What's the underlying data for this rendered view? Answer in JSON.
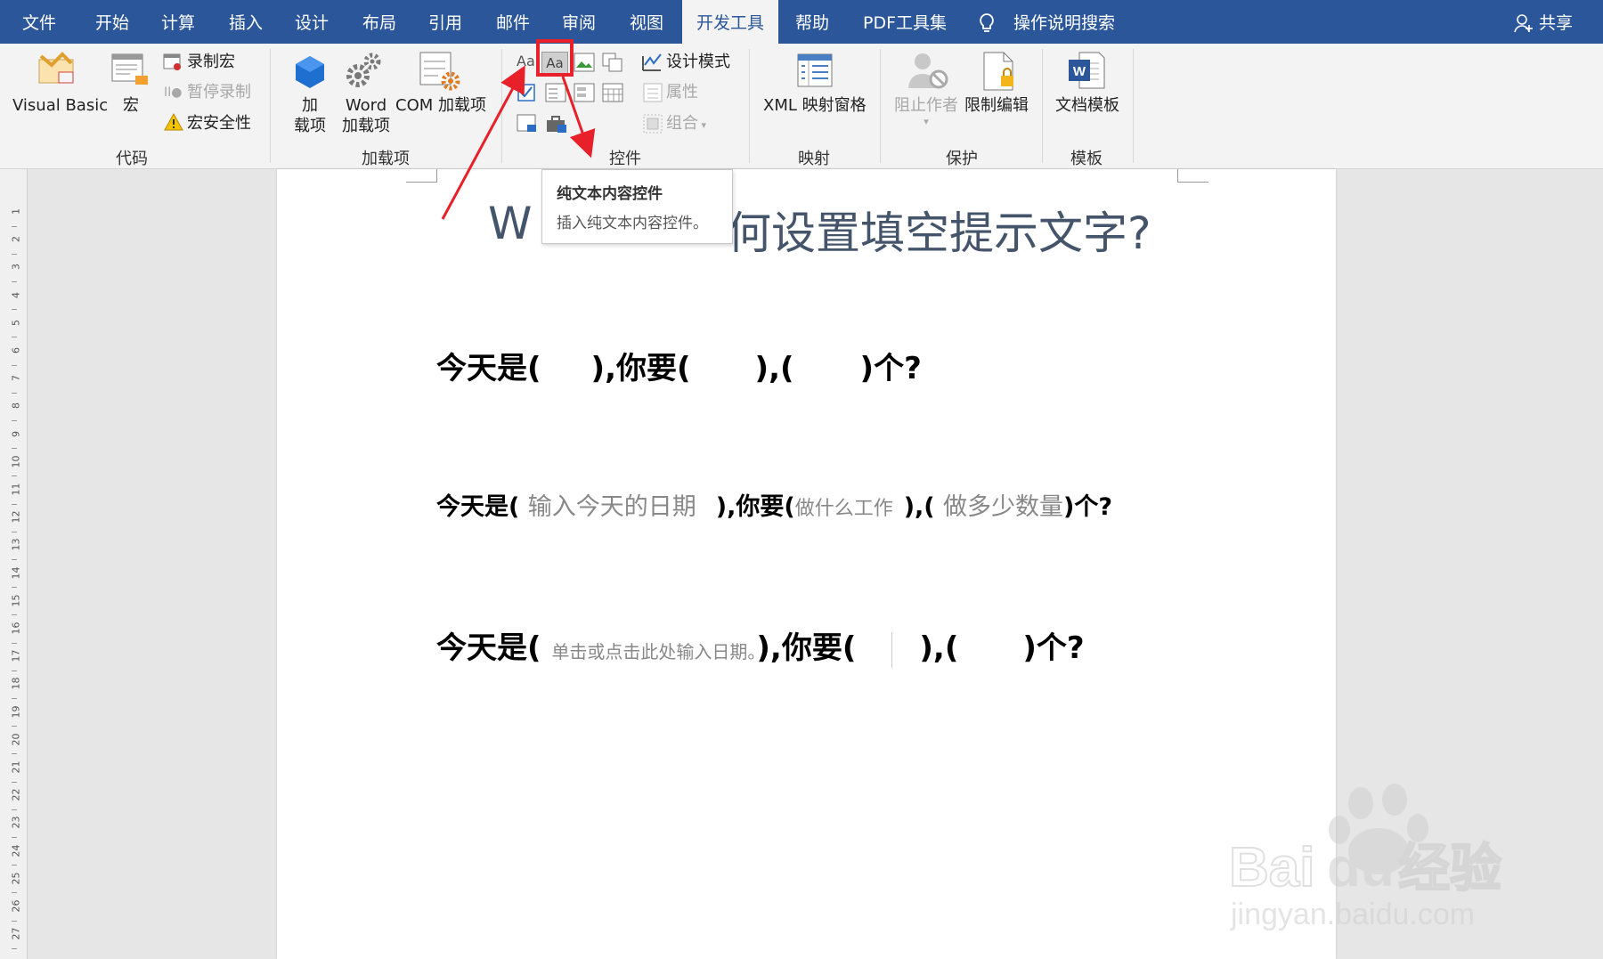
{
  "menu": {
    "tabs": [
      "文件",
      "开始",
      "计算",
      "插入",
      "设计",
      "布局",
      "引用",
      "邮件",
      "审阅",
      "视图",
      "开发工具",
      "帮助",
      "PDF工具集"
    ],
    "active_tab": "开发工具",
    "search_label": "操作说明搜索",
    "share_label": "共享"
  },
  "ribbon": {
    "code": {
      "label": "代码",
      "visual_basic": "Visual Basic",
      "macro": "宏",
      "record_macro": "录制宏",
      "pause_record": "暂停录制",
      "macro_security": "宏安全性"
    },
    "addins": {
      "label": "加载项",
      "addins_line1": "加",
      "addins_line2": "载项",
      "word_line1": "Word",
      "word_line2": "加载项",
      "com": "COM 加载项"
    },
    "controls": {
      "label": "控件",
      "design_mode": "设计模式",
      "properties": "属性",
      "group": "组合"
    },
    "mapping": {
      "label": "映射",
      "xml_pane": "XML 映射窗格"
    },
    "protect": {
      "label": "保护",
      "block_authors": "阻止作者",
      "restrict_editing": "限制编辑"
    },
    "templates": {
      "label": "模板",
      "doc_template": "文档模板"
    }
  },
  "tooltip": {
    "title": "纯文本内容控件",
    "desc": "插入纯文本内容控件。"
  },
  "document": {
    "title_left": "W",
    "title_right": "何设置填空提示文字?",
    "line1": {
      "a": "今天是(",
      "b": "),你要(",
      "c": "),(",
      "d": ")个?"
    },
    "line2": {
      "a": "今天是(",
      "ph1": "输入今天的日期",
      "b": "),你要(",
      "ph2": "做什么工作",
      "c": "),(",
      "ph3": "做多少数量",
      "d": ")个?"
    },
    "line3": {
      "a": "今天是(",
      "ph1": "单击或点击此处输入日期。",
      "b": "),你要(",
      "c": "),(",
      "d": ")个?"
    }
  },
  "ruler": {
    "numbers": [
      "1",
      "2",
      "3",
      "4",
      "5",
      "6",
      "7",
      "8",
      "9",
      "10",
      "11",
      "12",
      "13",
      "14",
      "15",
      "16",
      "17",
      "18",
      "19",
      "20",
      "21",
      "22",
      "23",
      "24",
      "25",
      "26",
      "27"
    ]
  },
  "watermark": {
    "brand": "Bai",
    "brand2": "du",
    "suffix": "经验",
    "url": "jingyan.baidu.com"
  },
  "colors": {
    "menubar": "#2b579a",
    "title": "#44546a",
    "annotation": "#e8202a"
  }
}
